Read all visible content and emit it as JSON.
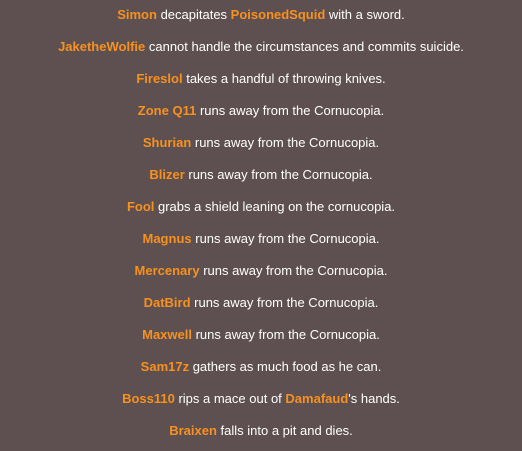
{
  "colors": {
    "background": "#5e5050",
    "text": "#ffffff",
    "player_name": "#f7911f"
  },
  "events": [
    {
      "parts": [
        {
          "t": "Simon",
          "name": true
        },
        {
          "t": " decapitates "
        },
        {
          "t": "PoisonedSquid",
          "name": true
        },
        {
          "t": " with a sword."
        }
      ]
    },
    {
      "parts": [
        {
          "t": "JaketheWolfie",
          "name": true
        },
        {
          "t": " cannot handle the circumstances and commits suicide."
        }
      ]
    },
    {
      "parts": [
        {
          "t": "Fireslol",
          "name": true
        },
        {
          "t": " takes a handful of throwing knives."
        }
      ]
    },
    {
      "parts": [
        {
          "t": "Zone Q11",
          "name": true
        },
        {
          "t": " runs away from the Cornucopia."
        }
      ]
    },
    {
      "parts": [
        {
          "t": "Shurian",
          "name": true
        },
        {
          "t": " runs away from the Cornucopia."
        }
      ]
    },
    {
      "parts": [
        {
          "t": "Blizer",
          "name": true
        },
        {
          "t": " runs away from the Cornucopia."
        }
      ]
    },
    {
      "parts": [
        {
          "t": "Fool",
          "name": true
        },
        {
          "t": " grabs a shield leaning on the cornucopia."
        }
      ]
    },
    {
      "parts": [
        {
          "t": "Magnus",
          "name": true
        },
        {
          "t": " runs away from the Cornucopia."
        }
      ]
    },
    {
      "parts": [
        {
          "t": "Mercenary",
          "name": true
        },
        {
          "t": " runs away from the Cornucopia."
        }
      ]
    },
    {
      "parts": [
        {
          "t": "DatBird",
          "name": true
        },
        {
          "t": " runs away from the Cornucopia."
        }
      ]
    },
    {
      "parts": [
        {
          "t": "Maxwell",
          "name": true
        },
        {
          "t": " runs away from the Cornucopia."
        }
      ]
    },
    {
      "parts": [
        {
          "t": "Sam17z",
          "name": true
        },
        {
          "t": " gathers as much food as he can."
        }
      ]
    },
    {
      "parts": [
        {
          "t": "Boss110",
          "name": true
        },
        {
          "t": " rips a mace out of "
        },
        {
          "t": "Damafaud",
          "name": true
        },
        {
          "t": "'s hands."
        }
      ]
    },
    {
      "parts": [
        {
          "t": "Braixen",
          "name": true
        },
        {
          "t": " falls into a pit and dies."
        }
      ]
    }
  ]
}
